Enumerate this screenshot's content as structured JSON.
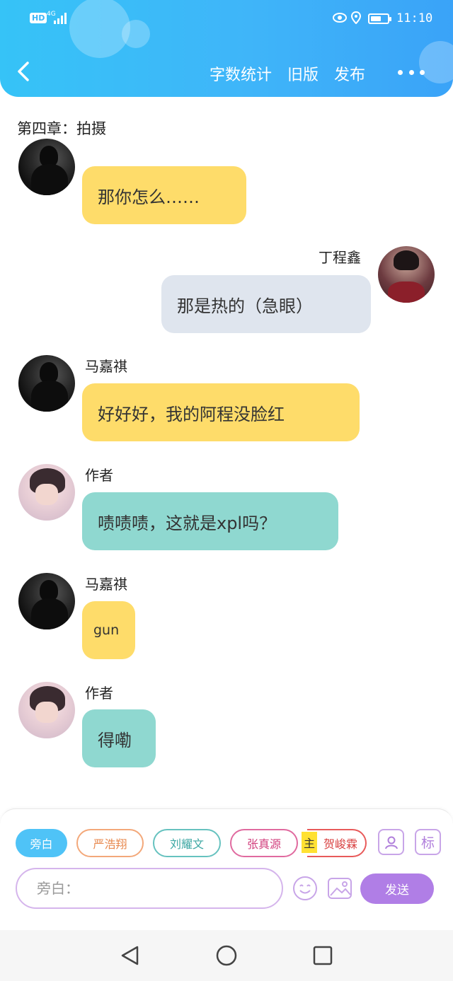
{
  "status_bar": {
    "hd_label": "HD",
    "network": "4G",
    "time": "11:10"
  },
  "header": {
    "actions": [
      "字数统计",
      "旧版",
      "发布"
    ]
  },
  "chapter_title": "第四章：拍摄",
  "messages": [
    {
      "speaker": "",
      "text": "那你怎么……",
      "side": "left",
      "color": "yellow",
      "avatar": "dark"
    },
    {
      "speaker": "丁程鑫",
      "text": "那是热的（急眼）",
      "side": "right",
      "color": "gray",
      "avatar": "ding"
    },
    {
      "speaker": "马嘉祺",
      "text": "好好好，我的阿程没脸红",
      "side": "left",
      "color": "yellow",
      "avatar": "dark"
    },
    {
      "speaker": "作者",
      "text": "啧啧啧，这就是xpl吗？",
      "side": "left",
      "color": "teal",
      "avatar": "author"
    },
    {
      "speaker": "马嘉祺",
      "text": "gun",
      "side": "left",
      "color": "yellow",
      "avatar": "dark"
    },
    {
      "speaker": "作者",
      "text": "得嘞",
      "side": "left",
      "color": "teal",
      "avatar": "author"
    }
  ],
  "composer": {
    "roles": [
      "旁白",
      "严浩翔",
      "刘耀文",
      "张真源",
      "贺峻霖"
    ],
    "main_tag": "主",
    "tag_button": "标",
    "input_placeholder": "旁白：",
    "send_label": "发送"
  },
  "colors": {
    "header": "#3ab6f8",
    "bubble_yellow": "#fedc6a",
    "bubble_gray": "#dfe5ee",
    "bubble_teal": "#8fd8d0",
    "send": "#b07ee6"
  }
}
